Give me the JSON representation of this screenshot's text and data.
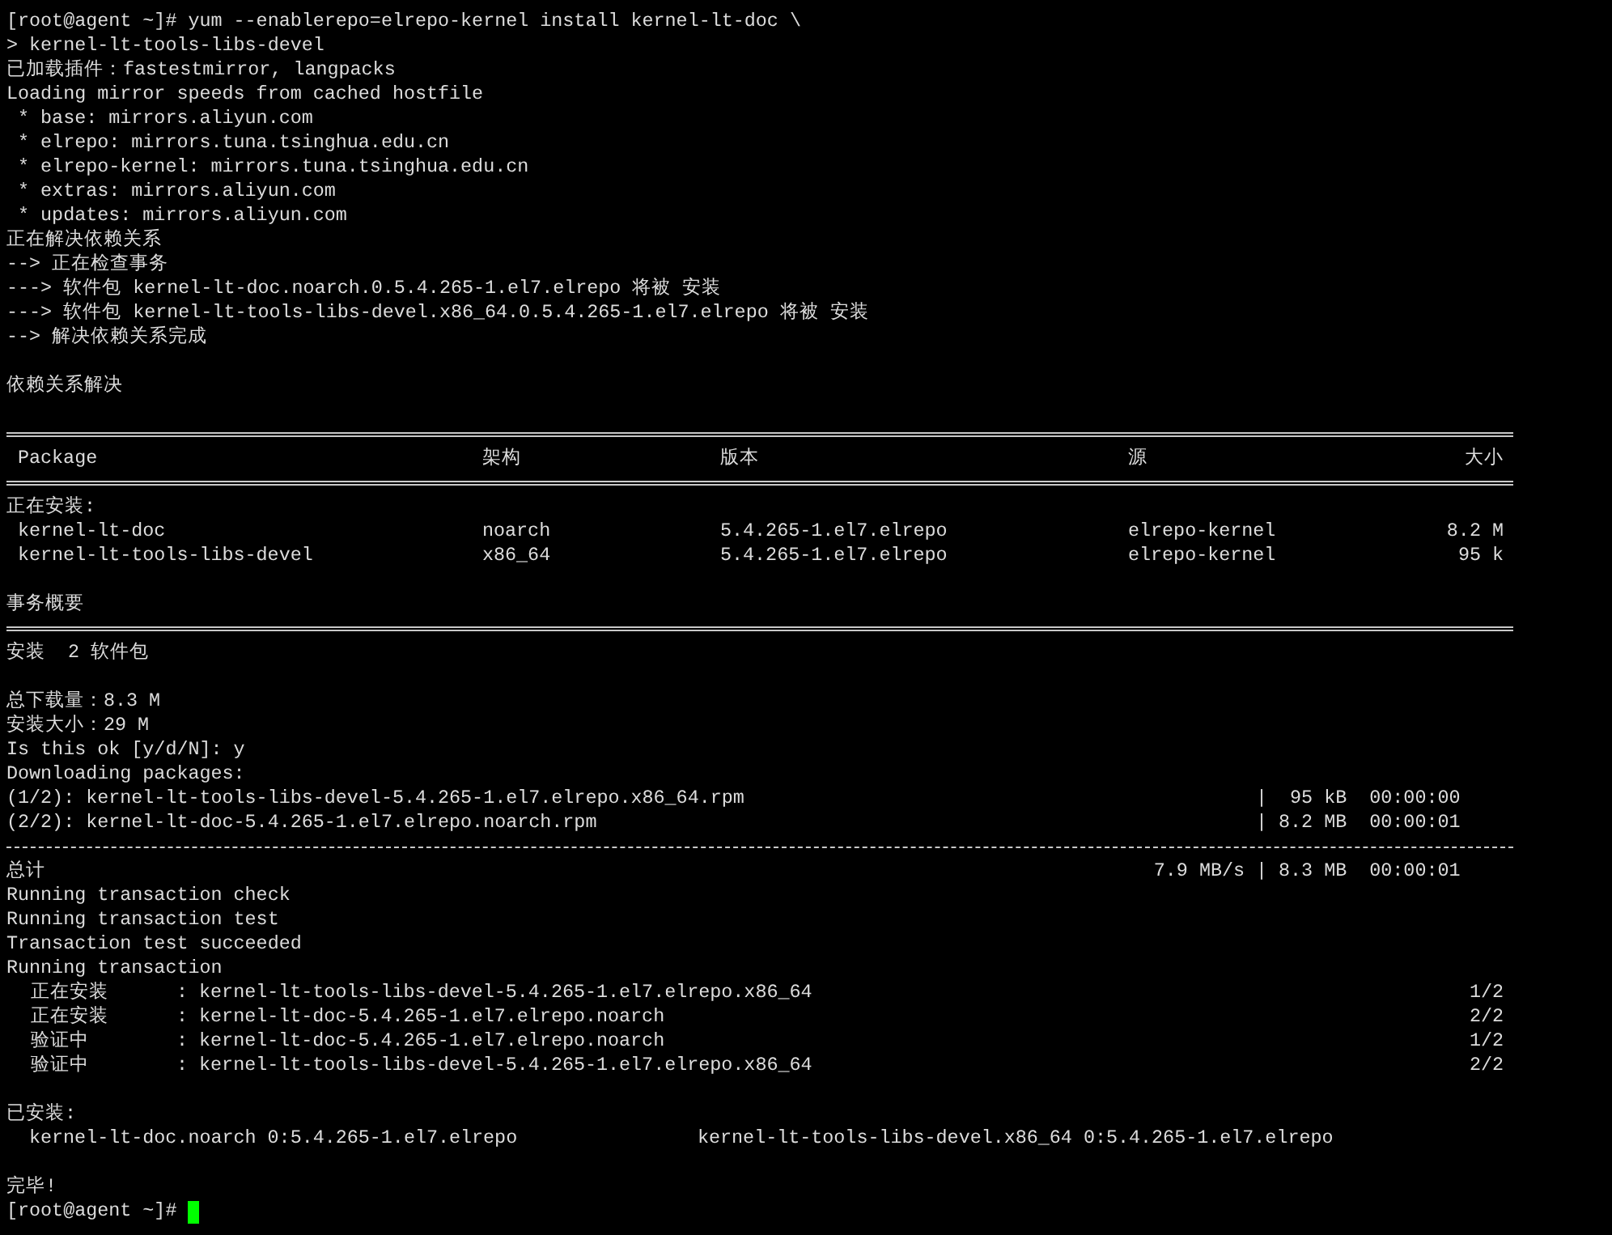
{
  "terminal": {
    "lines": [
      {
        "kind": "text",
        "text": "[root@agent ~]# yum --enablerepo=elrepo-kernel install kernel-lt-doc \\"
      },
      {
        "kind": "text",
        "text": "> kernel-lt-tools-libs-devel"
      },
      {
        "kind": "text",
        "text": "已加载插件：fastestmirror, langpacks"
      },
      {
        "kind": "text",
        "text": "Loading mirror speeds from cached hostfile"
      },
      {
        "kind": "text",
        "text": " * base: mirrors.aliyun.com"
      },
      {
        "kind": "text",
        "text": " * elrepo: mirrors.tuna.tsinghua.edu.cn"
      },
      {
        "kind": "text",
        "text": " * elrepo-kernel: mirrors.tuna.tsinghua.edu.cn"
      },
      {
        "kind": "text",
        "text": " * extras: mirrors.aliyun.com"
      },
      {
        "kind": "text",
        "text": " * updates: mirrors.aliyun.com"
      },
      {
        "kind": "text",
        "text": "正在解决依赖关系"
      },
      {
        "kind": "text",
        "text": "--> 正在检查事务"
      },
      {
        "kind": "text",
        "text": "---> 软件包 kernel-lt-doc.noarch.0.5.4.265-1.el7.elrepo 将被 安装"
      },
      {
        "kind": "text",
        "text": "---> 软件包 kernel-lt-tools-libs-devel.x86_64.0.5.4.265-1.el7.elrepo 将被 安装"
      },
      {
        "kind": "text",
        "text": "--> 解决依赖关系完成"
      },
      {
        "kind": "blank"
      },
      {
        "kind": "text",
        "text": "依赖关系解决"
      },
      {
        "kind": "blank"
      },
      {
        "kind": "double_rule"
      },
      {
        "kind": "table_header",
        "cells": [
          "Package",
          "架构",
          "版本",
          "源",
          "大小"
        ]
      },
      {
        "kind": "double_rule"
      },
      {
        "kind": "text",
        "text": "正在安装:"
      },
      {
        "kind": "table_row",
        "cells": [
          "kernel-lt-doc",
          "noarch",
          "5.4.265-1.el7.elrepo",
          "elrepo-kernel",
          "8.2 M"
        ]
      },
      {
        "kind": "table_row",
        "cells": [
          "kernel-lt-tools-libs-devel",
          "x86_64",
          "5.4.265-1.el7.elrepo",
          "elrepo-kernel",
          "95 k"
        ]
      },
      {
        "kind": "blank"
      },
      {
        "kind": "text",
        "text": "事务概要"
      },
      {
        "kind": "double_rule"
      },
      {
        "kind": "text",
        "text": "安装  2 软件包"
      },
      {
        "kind": "blank"
      },
      {
        "kind": "text",
        "text": "总下载量：8.3 M"
      },
      {
        "kind": "text",
        "text": "安装大小：29 M"
      },
      {
        "kind": "text",
        "text": "Is this ok [y/d/N]: y"
      },
      {
        "kind": "text",
        "text": "Downloading packages:"
      },
      {
        "kind": "download_row",
        "name": "(1/2): kernel-lt-tools-libs-devel-5.4.265-1.el7.elrepo.x86_64.rpm",
        "stats": "|  95 kB  00:00:00"
      },
      {
        "kind": "download_row",
        "name": "(2/2): kernel-lt-doc-5.4.265-1.el7.elrepo.noarch.rpm",
        "stats": "| 8.2 MB  00:00:01"
      },
      {
        "kind": "dashed_rule"
      },
      {
        "kind": "download_row",
        "name": "总计",
        "rate": "7.9 MB/s",
        "stats": "| 8.3 MB  00:00:01"
      },
      {
        "kind": "text",
        "text": "Running transaction check"
      },
      {
        "kind": "text",
        "text": "Running transaction test"
      },
      {
        "kind": "text",
        "text": "Transaction test succeeded"
      },
      {
        "kind": "text",
        "text": "Running transaction"
      },
      {
        "kind": "step_row",
        "label": "正在安装",
        "package": ": kernel-lt-tools-libs-devel-5.4.265-1.el7.elrepo.x86_64",
        "count": "1/2"
      },
      {
        "kind": "step_row",
        "label": "正在安装",
        "package": ": kernel-lt-doc-5.4.265-1.el7.elrepo.noarch",
        "count": "2/2"
      },
      {
        "kind": "step_row",
        "label": "验证中",
        "package": ": kernel-lt-doc-5.4.265-1.el7.elrepo.noarch",
        "count": "1/2"
      },
      {
        "kind": "step_row",
        "label": "验证中",
        "package": ": kernel-lt-tools-libs-devel-5.4.265-1.el7.elrepo.x86_64",
        "count": "2/2"
      },
      {
        "kind": "blank"
      },
      {
        "kind": "text",
        "text": "已安装:"
      },
      {
        "kind": "installed_row",
        "items": [
          "kernel-lt-doc.noarch 0:5.4.265-1.el7.elrepo",
          "kernel-lt-tools-libs-devel.x86_64 0:5.4.265-1.el7.elrepo"
        ]
      },
      {
        "kind": "blank"
      },
      {
        "kind": "text",
        "text": "完毕!"
      },
      {
        "kind": "prompt",
        "text": "[root@agent ~]#",
        "cursor": true
      }
    ]
  }
}
